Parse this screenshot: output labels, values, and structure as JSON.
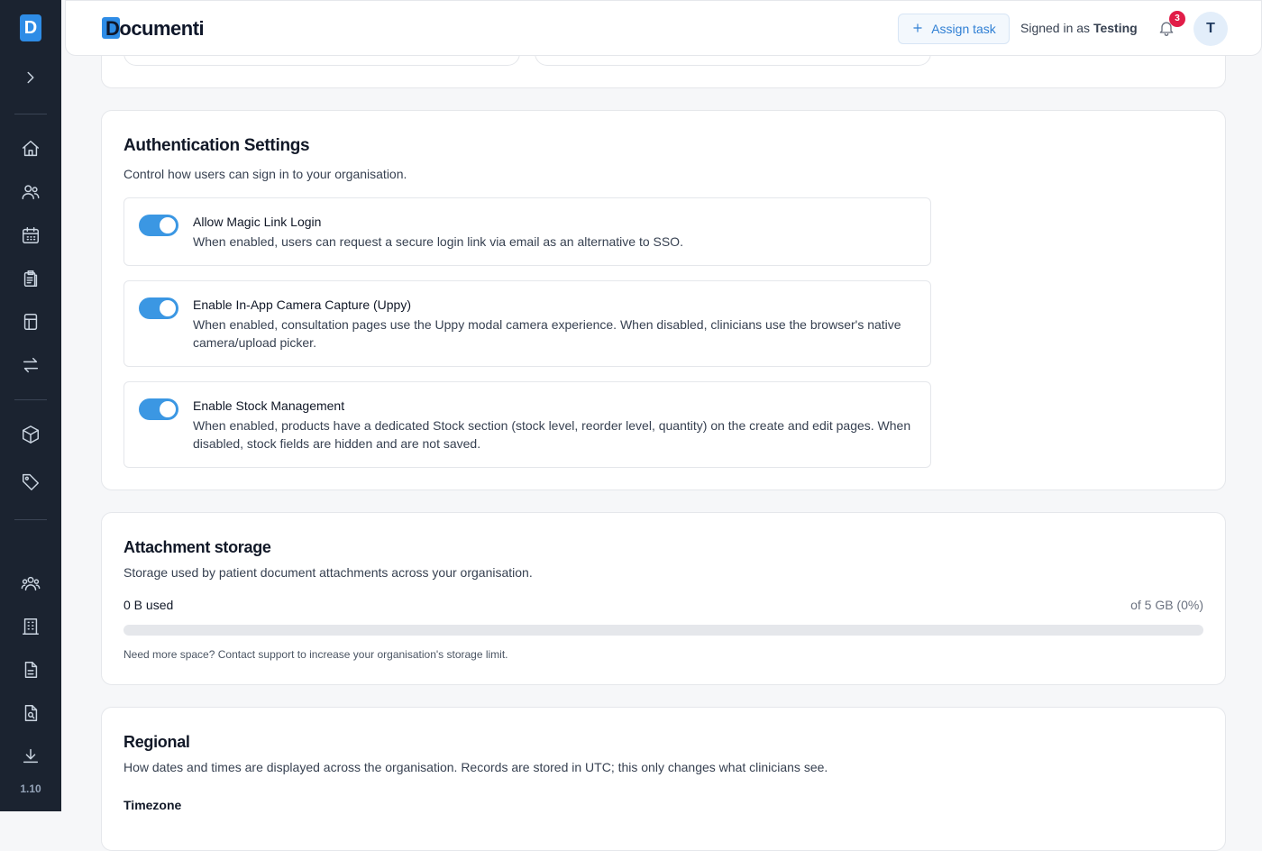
{
  "app": {
    "logo_letter": "D",
    "brand": "Documenti",
    "version": "1.10",
    "accent": "#2e8ce6"
  },
  "sidebar": {
    "icons": [
      "chevron-right-icon",
      "home-icon",
      "users-icon",
      "calendar-icon",
      "clipboard-icon",
      "calculator-icon",
      "transfer-icon",
      "box-icon",
      "tag-icon",
      "team-icon",
      "building-icon",
      "document-icon",
      "file-search-icon",
      "download-icon"
    ]
  },
  "header": {
    "assign_label": "Assign task",
    "signed_prefix": "Signed in as",
    "user_name": "Testing",
    "notification_count": "3",
    "avatar_initial": "T"
  },
  "auth": {
    "title": "Authentication Settings",
    "subtitle": "Control how users can sign in to your organisation.",
    "options": [
      {
        "title": "Allow Magic Link Login",
        "desc": "When enabled, users can request a secure login link via email as an alternative to SSO.",
        "enabled": true
      },
      {
        "title": "Enable In-App Camera Capture (Uppy)",
        "desc": "When enabled, consultation pages use the Uppy modal camera experience. When disabled, clinicians use the browser's native camera/upload picker.",
        "enabled": true
      },
      {
        "title": "Enable Stock Management",
        "desc": "When enabled, products have a dedicated Stock section (stock level, reorder level, quantity) on the create and edit pages. When disabled, stock fields are hidden and are not saved.",
        "enabled": true
      }
    ]
  },
  "storage": {
    "title": "Attachment storage",
    "subtitle": "Storage used by patient document attachments across your organisation.",
    "used": "0 B used",
    "of": "of 5 GB (0%)",
    "percent": 0,
    "note": "Need more space? Contact support to increase your organisation's storage limit."
  },
  "regional": {
    "title": "Regional",
    "subtitle": "How dates and times are displayed across the organisation. Records are stored in UTC; this only changes what clinicians see.",
    "timezone_label": "Timezone"
  }
}
